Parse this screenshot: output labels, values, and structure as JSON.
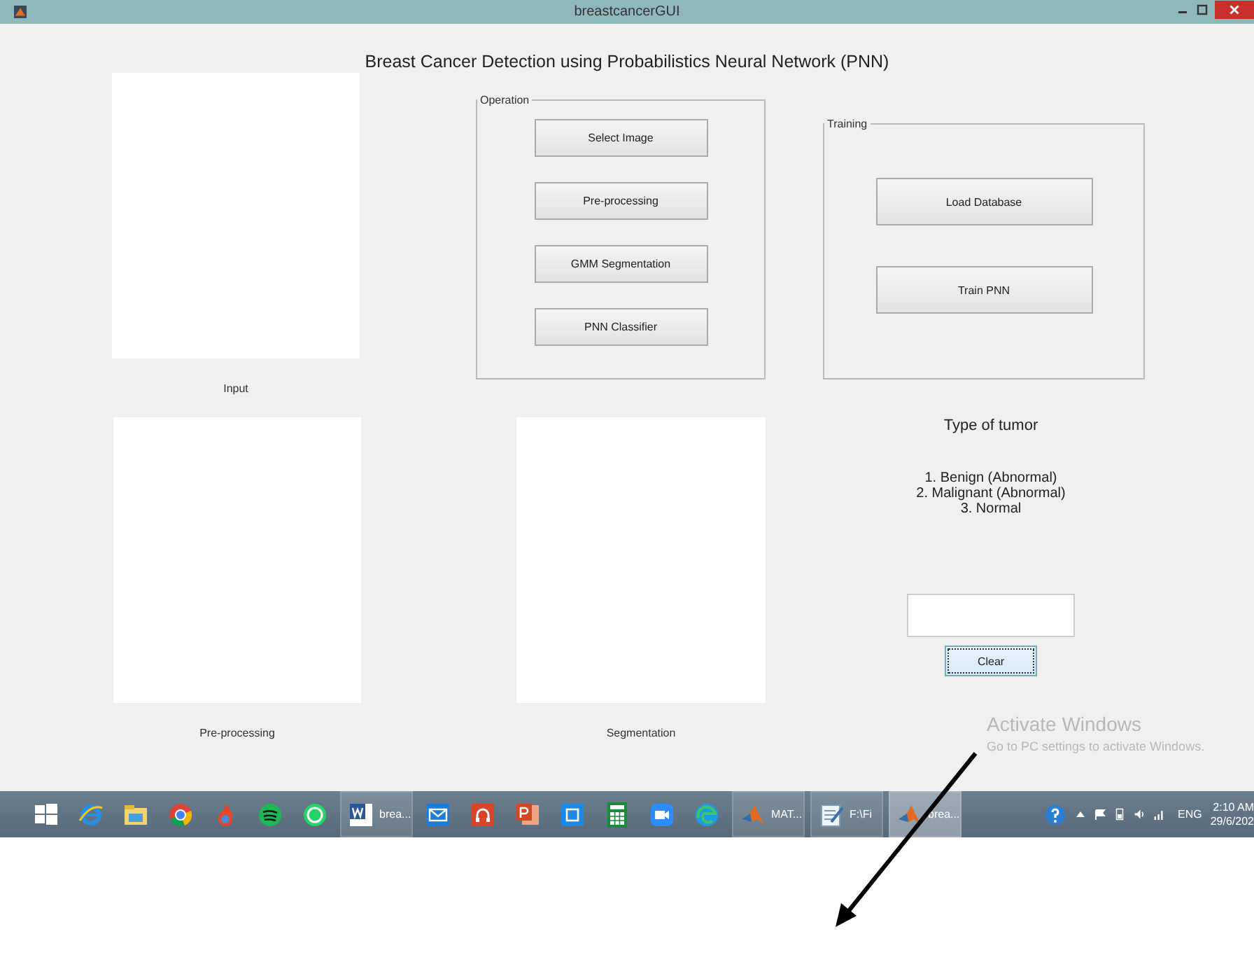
{
  "window": {
    "title": "breastcancerGUI"
  },
  "heading": "Breast Cancer Detection using Probabilistics Neural Network (PNN)",
  "axes": [
    {
      "label": "Input"
    },
    {
      "label": "Pre-processing"
    },
    {
      "label": "Segmentation"
    }
  ],
  "operation_panel": {
    "title": "Operation",
    "buttons": [
      "Select Image",
      "Pre-processing",
      "GMM Segmentation",
      "PNN Classifier"
    ]
  },
  "training_panel": {
    "title": "Training",
    "buttons": [
      "Load Database",
      "Train PNN"
    ]
  },
  "tumor": {
    "title": "Type of tumor",
    "types": [
      "1. Benign (Abnormal)",
      "2. Malignant (Abnormal)",
      "3. Normal"
    ]
  },
  "clear_button": {
    "label": "Clear",
    "focused": true
  },
  "activation_notice": {
    "title": "Activate Windows",
    "text": "Go to PC settings to activate Windows."
  },
  "taskbar": {
    "apps": [
      {
        "kind": "start",
        "selected": false
      },
      {
        "kind": "ie",
        "selected": false
      },
      {
        "kind": "folder",
        "selected": false
      },
      {
        "kind": "chrome",
        "selected": false
      },
      {
        "kind": "flame",
        "selected": false
      },
      {
        "kind": "spotify",
        "selected": false
      },
      {
        "kind": "whatsapp",
        "selected": false
      },
      {
        "kind": "word",
        "label": "brea...",
        "selected": false
      },
      {
        "kind": "mail",
        "selected": false
      },
      {
        "kind": "headphones",
        "selected": false
      },
      {
        "kind": "powerpoint",
        "selected": false
      },
      {
        "kind": "capture",
        "selected": false
      },
      {
        "kind": "calculator",
        "selected": false
      },
      {
        "kind": "camera",
        "selected": false
      },
      {
        "kind": "edge",
        "selected": false
      },
      {
        "kind": "matlab",
        "label": "MAT...",
        "selected": false
      },
      {
        "kind": "notepad",
        "label": "F:\\Fi",
        "selected": false
      },
      {
        "kind": "matlab",
        "label": "brea...",
        "selected": true
      }
    ],
    "language": "ENG",
    "time": "2:10 AM",
    "date": "29/6/202"
  }
}
